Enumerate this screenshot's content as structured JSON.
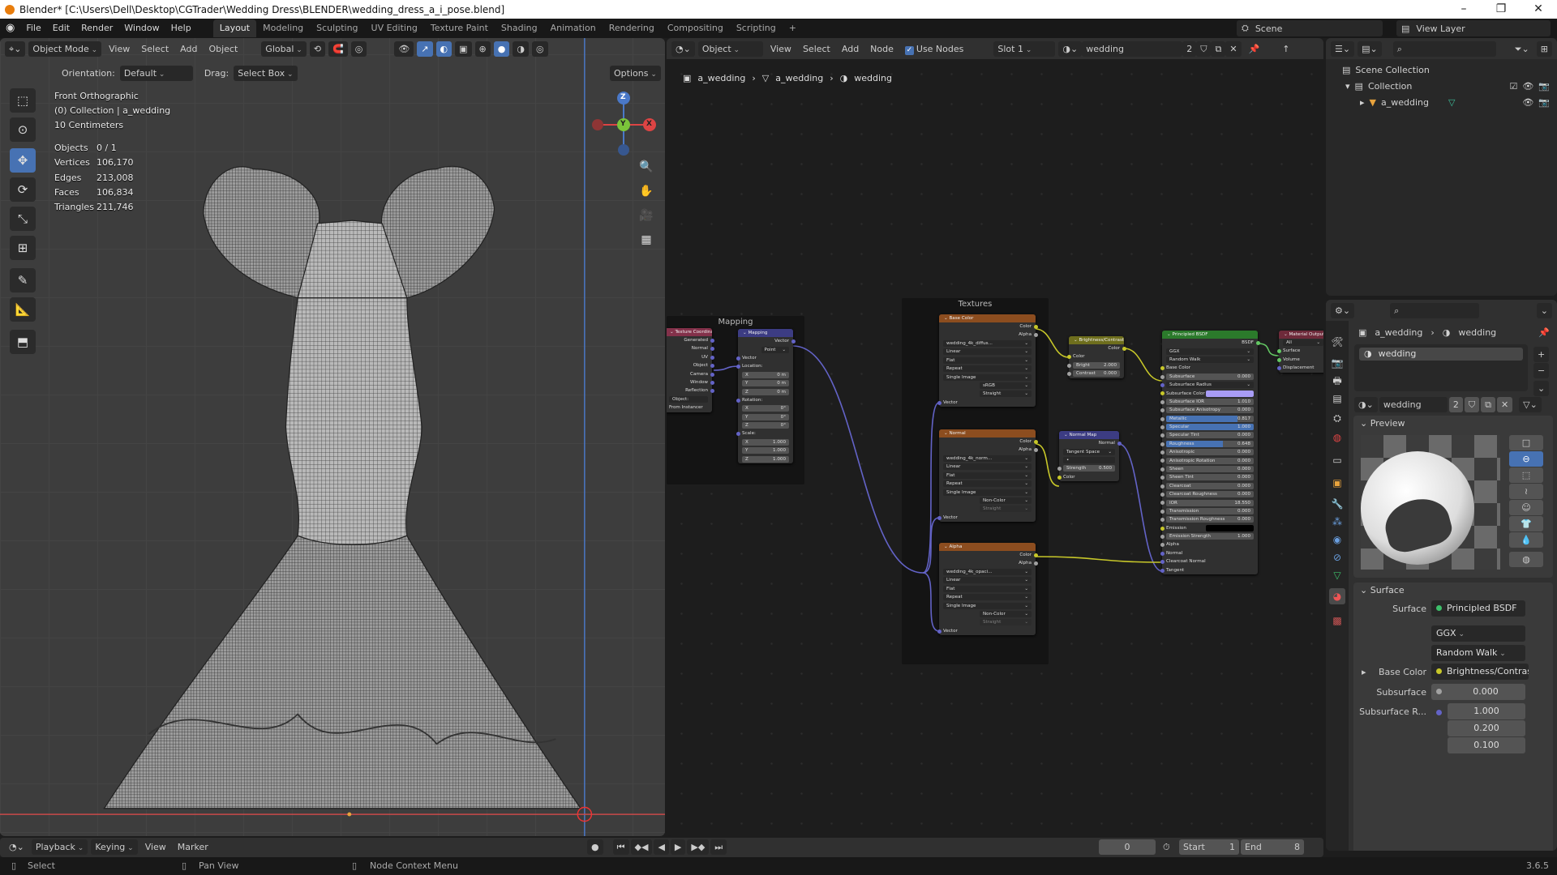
{
  "window": {
    "title": "Blender* [C:\\Users\\Dell\\Desktop\\CGTrader\\Wedding Dress\\BLENDER\\wedding_dress_a_i_pose.blend]",
    "minimize": "–",
    "maximize": "❐",
    "close": "✕"
  },
  "menu": {
    "items": [
      "File",
      "Edit",
      "Render",
      "Window",
      "Help"
    ]
  },
  "workspaces": {
    "items": [
      "Layout",
      "Modeling",
      "Sculpting",
      "UV Editing",
      "Texture Paint",
      "Shading",
      "Animation",
      "Rendering",
      "Compositing",
      "Scripting",
      "+"
    ],
    "active": "Layout"
  },
  "scene": {
    "name": "Scene",
    "view_layer": "View Layer"
  },
  "viewport": {
    "mode": "Object Mode",
    "menus": [
      "View",
      "Select",
      "Add",
      "Object"
    ],
    "transform": "Global",
    "orientation_label": "Orientation:",
    "orientation": "Default",
    "drag_label": "Drag:",
    "drag": "Select Box",
    "options": "Options",
    "view_name": "Front Orthographic",
    "collection": "(0) Collection | a_wedding",
    "scale": "10 Centimeters",
    "stats": [
      [
        "Objects",
        "0 / 1"
      ],
      [
        "Vertices",
        "106,170"
      ],
      [
        "Edges",
        "213,008"
      ],
      [
        "Faces",
        "106,834"
      ],
      [
        "Triangles",
        "211,746"
      ]
    ],
    "gizmo": {
      "z": "Z",
      "y": "Y",
      "x": "X"
    }
  },
  "node_editor": {
    "object_type": "Object",
    "menus": [
      "View",
      "Select",
      "Add",
      "Node"
    ],
    "use_nodes_label": "Use Nodes",
    "use_nodes": true,
    "slot": "Slot 1",
    "material": "wedding",
    "users": "2",
    "breadcrumb": [
      "a_wedding",
      "a_wedding",
      "wedding"
    ],
    "frames": [
      "Mapping",
      "Textures"
    ],
    "nodes": [
      {
        "id": "texcoord",
        "title": "Texture Coordinate",
        "color": "#83314a",
        "rows": [
          {
            "t": "out",
            "l": "Generated",
            "s": "#6363c7"
          },
          {
            "t": "out",
            "l": "Normal",
            "s": "#6363c7"
          },
          {
            "t": "out",
            "l": "UV",
            "s": "#6363c7"
          },
          {
            "t": "out",
            "l": "Object",
            "s": "#6363c7"
          },
          {
            "t": "out",
            "l": "Camera",
            "s": "#6363c7"
          },
          {
            "t": "out",
            "l": "Window",
            "s": "#6363c7"
          },
          {
            "t": "out",
            "l": "Reflection",
            "s": "#6363c7"
          },
          {
            "t": "field",
            "l": "Object:"
          },
          {
            "t": "label",
            "l": "From Instancer"
          }
        ]
      },
      {
        "id": "mapping",
        "title": "Mapping",
        "color": "#3c3c83",
        "rows": [
          {
            "t": "out",
            "l": "Vector",
            "s": "#6363c7"
          },
          {
            "t": "select",
            "l": "Point",
            "p": "Type:"
          },
          {
            "t": "in",
            "l": "Vector",
            "s": "#6363c7"
          },
          {
            "t": "in",
            "l": "Location:",
            "s": "#6363c7"
          },
          {
            "t": "value",
            "l": "X",
            "v": "0 m"
          },
          {
            "t": "value",
            "l": "Y",
            "v": "0 m"
          },
          {
            "t": "value",
            "l": "Z",
            "v": "0 m"
          },
          {
            "t": "in",
            "l": "Rotation:",
            "s": "#6363c7"
          },
          {
            "t": "value",
            "l": "X",
            "v": "0°"
          },
          {
            "t": "value",
            "l": "Y",
            "v": "0°"
          },
          {
            "t": "value",
            "l": "Z",
            "v": "0°"
          },
          {
            "t": "in",
            "l": "Scale:",
            "s": "#6363c7"
          },
          {
            "t": "value",
            "l": "X",
            "v": "1.000"
          },
          {
            "t": "value",
            "l": "Y",
            "v": "1.000"
          },
          {
            "t": "value",
            "l": "Z",
            "v": "1.000"
          }
        ]
      },
      {
        "id": "tex_base",
        "title": "Base Color",
        "color": "#8c4d1f",
        "rows": [
          {
            "t": "out",
            "l": "Color",
            "s": "#c7c729"
          },
          {
            "t": "out",
            "l": "Alpha",
            "s": "#a1a1a1"
          },
          {
            "t": "select",
            "l": "wedding_4k_diffus..."
          },
          {
            "t": "select",
            "l": "Linear"
          },
          {
            "t": "select",
            "l": "Flat"
          },
          {
            "t": "select",
            "l": "Repeat"
          },
          {
            "t": "select",
            "l": "Single Image"
          },
          {
            "t": "select",
            "l": "sRGB",
            "p": "Color Space"
          },
          {
            "t": "select",
            "l": "Straight",
            "p": "Alpha"
          },
          {
            "t": "in",
            "l": "Vector",
            "s": "#6363c7"
          }
        ]
      },
      {
        "id": "tex_normal",
        "title": "Normal",
        "color": "#8c4d1f",
        "rows": [
          {
            "t": "out",
            "l": "Color",
            "s": "#c7c729"
          },
          {
            "t": "out",
            "l": "Alpha",
            "s": "#a1a1a1"
          },
          {
            "t": "select",
            "l": "wedding_4k_norm..."
          },
          {
            "t": "select",
            "l": "Linear"
          },
          {
            "t": "select",
            "l": "Flat"
          },
          {
            "t": "select",
            "l": "Repeat"
          },
          {
            "t": "select",
            "l": "Single Image"
          },
          {
            "t": "select",
            "l": "Non-Color",
            "p": "Color Space"
          },
          {
            "t": "select",
            "l": "Straight",
            "p": "Alpha",
            "dim": true
          },
          {
            "t": "in",
            "l": "Vector",
            "s": "#6363c7"
          }
        ]
      },
      {
        "id": "tex_alpha",
        "title": "Alpha",
        "color": "#8c4d1f",
        "rows": [
          {
            "t": "out",
            "l": "Color",
            "s": "#c7c729"
          },
          {
            "t": "out",
            "l": "Alpha",
            "s": "#a1a1a1"
          },
          {
            "t": "select",
            "l": "wedding_4k_opaci..."
          },
          {
            "t": "select",
            "l": "Linear"
          },
          {
            "t": "select",
            "l": "Flat"
          },
          {
            "t": "select",
            "l": "Repeat"
          },
          {
            "t": "select",
            "l": "Single Image"
          },
          {
            "t": "select",
            "l": "Non-Color",
            "p": "Color Space"
          },
          {
            "t": "select",
            "l": "Straight",
            "p": "Alpha",
            "dim": true
          },
          {
            "t": "in",
            "l": "Vector",
            "s": "#6363c7"
          }
        ]
      },
      {
        "id": "brightness",
        "title": "Brightness/Contrast",
        "color": "#6e6e1d",
        "rows": [
          {
            "t": "out",
            "l": "Color",
            "s": "#c7c729"
          },
          {
            "t": "in",
            "l": "Color",
            "s": "#c7c729"
          },
          {
            "t": "value",
            "l": "Bright",
            "v": "2.000",
            "s": "#a1a1a1"
          },
          {
            "t": "value",
            "l": "Contrast",
            "v": "0.000",
            "s": "#a1a1a1"
          }
        ]
      },
      {
        "id": "normalmap",
        "title": "Normal Map",
        "color": "#3c3c83",
        "rows": [
          {
            "t": "out",
            "l": "Normal",
            "s": "#6363c7"
          },
          {
            "t": "select",
            "l": "Tangent Space"
          },
          {
            "t": "field",
            "l": "•"
          },
          {
            "t": "value",
            "l": "Strength",
            "v": "0.500",
            "s": "#a1a1a1"
          },
          {
            "t": "in",
            "l": "Color",
            "s": "#c7c729"
          }
        ]
      },
      {
        "id": "principled",
        "title": "Principled BSDF",
        "color": "#2b7a2b",
        "rows": [
          {
            "t": "out",
            "l": "BSDF",
            "s": "#63c763"
          },
          {
            "t": "select",
            "l": "GGX"
          },
          {
            "t": "select",
            "l": "Random Walk"
          },
          {
            "t": "in",
            "l": "Base Color",
            "s": "#c7c729"
          },
          {
            "t": "value",
            "l": "Subsurface",
            "v": "0.000",
            "s": "#a1a1a1"
          },
          {
            "t": "select",
            "l": "Subsurface Radius",
            "s": "#6363c7",
            "box": true
          },
          {
            "t": "color",
            "l": "Subsurface Color",
            "c": "#a89cf5",
            "s": "#c7c729"
          },
          {
            "t": "value",
            "l": "Subsurface IOR",
            "v": "1.010",
            "s": "#a1a1a1"
          },
          {
            "t": "value",
            "l": "Subsurface Anisotropy",
            "v": "0.000",
            "s": "#a1a1a1"
          },
          {
            "t": "value",
            "l": "Metallic",
            "v": "0.817",
            "f": 0.817,
            "s": "#a1a1a1"
          },
          {
            "t": "value",
            "l": "Specular",
            "v": "1.000",
            "f": 1.0,
            "s": "#a1a1a1"
          },
          {
            "t": "value",
            "l": "Specular Tint",
            "v": "0.000",
            "s": "#a1a1a1"
          },
          {
            "t": "value",
            "l": "Roughness",
            "v": "0.648",
            "f": 0.648,
            "s": "#a1a1a1"
          },
          {
            "t": "value",
            "l": "Anisotropic",
            "v": "0.000",
            "s": "#a1a1a1"
          },
          {
            "t": "value",
            "l": "Anisotropic Rotation",
            "v": "0.000",
            "s": "#a1a1a1"
          },
          {
            "t": "value",
            "l": "Sheen",
            "v": "0.000",
            "s": "#a1a1a1"
          },
          {
            "t": "value",
            "l": "Sheen Tint",
            "v": "0.000",
            "s": "#a1a1a1"
          },
          {
            "t": "value",
            "l": "Clearcoat",
            "v": "0.000",
            "s": "#a1a1a1"
          },
          {
            "t": "value",
            "l": "Clearcoat Roughness",
            "v": "0.000",
            "s": "#a1a1a1"
          },
          {
            "t": "value",
            "l": "IOR",
            "v": "18.550",
            "s": "#a1a1a1"
          },
          {
            "t": "value",
            "l": "Transmission",
            "v": "0.000",
            "s": "#a1a1a1"
          },
          {
            "t": "value",
            "l": "Transmission Roughness",
            "v": "0.000",
            "s": "#a1a1a1"
          },
          {
            "t": "color",
            "l": "Emission",
            "c": "#000000",
            "s": "#c7c729"
          },
          {
            "t": "value",
            "l": "Emission Strength",
            "v": "1.000",
            "s": "#a1a1a1"
          },
          {
            "t": "in",
            "l": "Alpha",
            "s": "#a1a1a1"
          },
          {
            "t": "in",
            "l": "Normal",
            "s": "#6363c7"
          },
          {
            "t": "in",
            "l": "Clearcoat Normal",
            "s": "#6363c7"
          },
          {
            "t": "in",
            "l": "Tangent",
            "s": "#6363c7"
          }
        ]
      },
      {
        "id": "output",
        "title": "Material Output",
        "color": "#6e2a3a",
        "rows": [
          {
            "t": "select",
            "l": "All"
          },
          {
            "t": "in",
            "l": "Surface",
            "s": "#63c763"
          },
          {
            "t": "in",
            "l": "Volume",
            "s": "#63c763"
          },
          {
            "t": "in",
            "l": "Displacement",
            "s": "#6363c7"
          }
        ]
      }
    ]
  },
  "outliner": {
    "root": "Scene Collection",
    "collection": "Collection",
    "object": "a_wedding"
  },
  "properties": {
    "breadcrumb": [
      "a_wedding",
      "wedding"
    ],
    "slot_item": "wedding",
    "material": "wedding",
    "users": "2",
    "preview_label": "Preview",
    "surface_label": "Surface",
    "surface": {
      "label": "Surface",
      "value": "Principled BSDF"
    },
    "distribution": "GGX",
    "subsurface_method": "Random Walk",
    "base_color": {
      "label": "Base Color",
      "value": "Brightness/Contrast"
    },
    "subsurface": {
      "label": "Subsurface",
      "value": "0.000"
    },
    "subsurface_radius": {
      "label": "Subsurface R...",
      "values": [
        "1.000",
        "0.200",
        "0.100"
      ]
    }
  },
  "timeline": {
    "menus": [
      "Playback",
      "Keying",
      "View",
      "Marker"
    ],
    "frame": "0",
    "start_label": "Start",
    "start": "1",
    "end_label": "End",
    "end": "8"
  },
  "status": {
    "select": "Select",
    "pan": "Pan View",
    "context": "Node Context Menu",
    "version": "3.6.5"
  },
  "colors": {
    "accent": "#4772b3",
    "selected_origin": "#e8a33d"
  }
}
